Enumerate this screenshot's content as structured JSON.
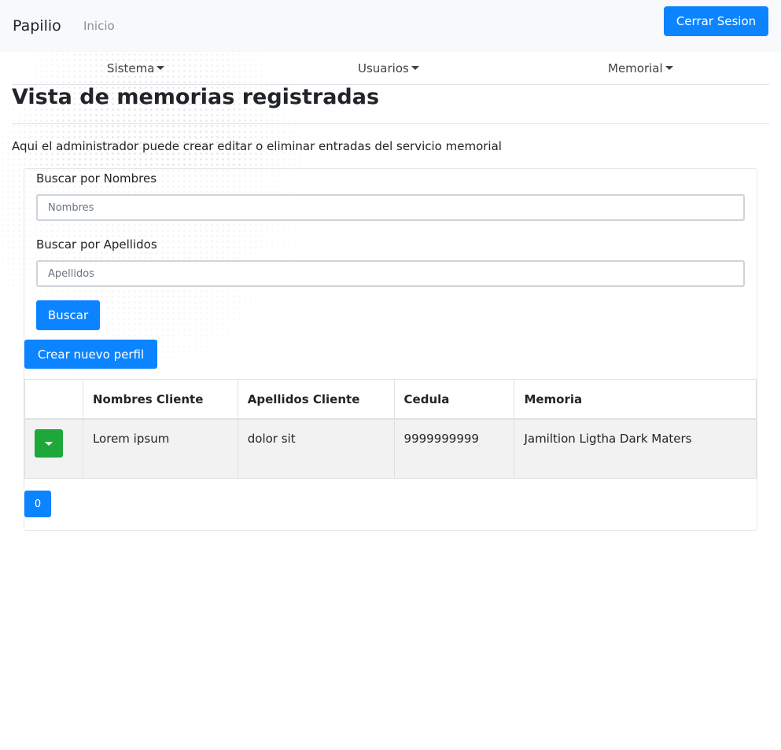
{
  "navbar": {
    "brand": "Papilio",
    "home_link": "Inicio",
    "logout_label": "Cerrar Sesion"
  },
  "menu": {
    "items": [
      {
        "label": "Sistema"
      },
      {
        "label": "Usuarios"
      },
      {
        "label": "Memorial"
      }
    ]
  },
  "page": {
    "title": "Vista de memorias registradas",
    "description": "Aqui el administrador puede crear editar o eliminar entradas del servicio memorial"
  },
  "search": {
    "names_label": "Buscar por Nombres",
    "names_placeholder": "Nombres",
    "names_value": "",
    "surnames_label": "Buscar por Apellidos",
    "surnames_placeholder": "Apellidos",
    "surnames_value": "",
    "button_label": "Buscar"
  },
  "create_button_label": "Crear nuevo perfil",
  "table": {
    "headers": [
      "",
      "Nombres Cliente",
      "Apellidos Cliente",
      "Cedula",
      "Memoria"
    ],
    "rows": [
      {
        "nombres": "Lorem ipsum",
        "apellidos": "dolor sit",
        "cedula": "9999999999",
        "memoria": "Jamiltion Ligtha Dark Maters"
      }
    ]
  },
  "pagination": {
    "current_page": "0"
  },
  "colors": {
    "primary": "#0d84ff",
    "action": "#1ea83a",
    "navbar_bg": "#f8f9fa",
    "row_bg": "#f2f2f2"
  }
}
